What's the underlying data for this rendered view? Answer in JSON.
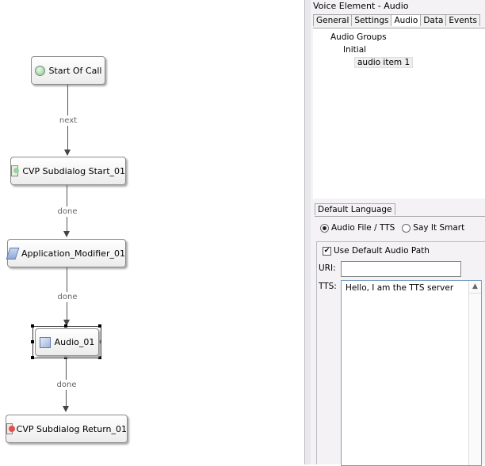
{
  "flow": {
    "nodes": [
      {
        "id": "start",
        "label": "Start Of Call",
        "icon": "start-circle-icon"
      },
      {
        "id": "subdialog_start",
        "label": "CVP Subdialog Start_01",
        "icon": "subdialog-start-icon"
      },
      {
        "id": "app_modifier",
        "label": "Application_Modifier_01",
        "icon": "application-modifier-icon"
      },
      {
        "id": "audio",
        "label": "Audio_01",
        "icon": "audio-element-icon",
        "selected": true
      },
      {
        "id": "subdialog_return",
        "label": "CVP Subdialog Return_01",
        "icon": "subdialog-return-icon"
      }
    ],
    "connections": [
      {
        "from": "start",
        "to": "subdialog_start",
        "label": "next"
      },
      {
        "from": "subdialog_start",
        "to": "app_modifier",
        "label": "done"
      },
      {
        "from": "app_modifier",
        "to": "audio",
        "label": "done"
      },
      {
        "from": "audio",
        "to": "subdialog_return",
        "label": "done"
      }
    ]
  },
  "panel": {
    "title": "Voice Element - Audio",
    "tabs": [
      "General",
      "Settings",
      "Audio",
      "Data",
      "Events"
    ],
    "active_tab": "Audio",
    "tree": {
      "root": "Audio Groups",
      "group": "Initial",
      "item": "audio item 1"
    },
    "language_tab": "Default Language",
    "radio_options": [
      "Audio File / TTS",
      "Say It Smart"
    ],
    "radio_selected": "Audio File / TTS",
    "use_default_path_label": "Use Default Audio Path",
    "use_default_path_checked": true,
    "uri_label": "URI:",
    "uri_value": "",
    "tts_label": "TTS:",
    "tts_value": "Hello, I am the TTS server",
    "check_mark": "✔",
    "scroll_up": "▲"
  }
}
